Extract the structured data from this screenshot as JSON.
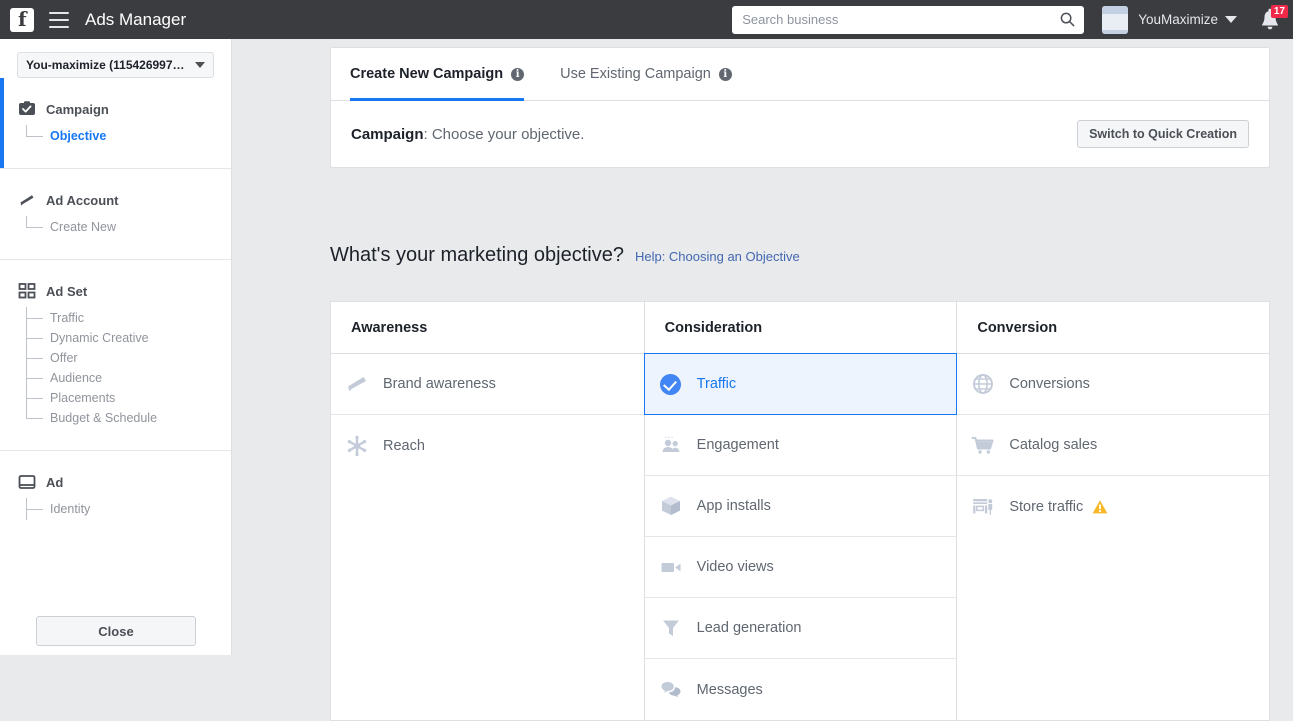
{
  "topbar": {
    "logo_icon": "facebook-logo-icon",
    "menu_icon": "hamburger-menu-icon",
    "app_title": "Ads Manager",
    "search": {
      "placeholder": "Search business",
      "value": "",
      "icon": "search-icon"
    },
    "business_icon": "business-portfolio-icon",
    "business_name": "YouMaximize",
    "business_caret_icon": "chevron-down-icon",
    "notifications": {
      "icon": "bell-icon",
      "count": "17"
    }
  },
  "sidebar": {
    "account_selector": {
      "label": "You-maximize (115426997…",
      "caret_icon": "chevron-down-icon"
    },
    "sections": [
      {
        "title": "Campaign",
        "icon": "campaign-check-icon",
        "active": true,
        "children": [
          {
            "label": "Objective",
            "selected": true
          }
        ]
      },
      {
        "title": "Ad Account",
        "icon": "megaphone-icon",
        "active": false,
        "children": [
          {
            "label": "Create New",
            "selected": false
          }
        ]
      },
      {
        "title": "Ad Set",
        "icon": "grid-squares-icon",
        "active": false,
        "children": [
          {
            "label": "Traffic",
            "selected": false
          },
          {
            "label": "Dynamic Creative",
            "selected": false
          },
          {
            "label": "Offer",
            "selected": false
          },
          {
            "label": "Audience",
            "selected": false
          },
          {
            "label": "Placements",
            "selected": false
          },
          {
            "label": "Budget & Schedule",
            "selected": false
          }
        ]
      },
      {
        "title": "Ad",
        "icon": "ad-window-icon",
        "active": false,
        "children": [
          {
            "label": "Identity",
            "selected": false
          }
        ]
      }
    ],
    "close_button": "Close"
  },
  "main": {
    "tabs": [
      {
        "label": "Create New Campaign",
        "active": true,
        "info_icon": "info-icon",
        "info_glyph": "i"
      },
      {
        "label": "Use Existing Campaign",
        "active": false,
        "info_icon": "info-icon",
        "info_glyph": "i"
      }
    ],
    "campaign_bar": {
      "bold_prefix": "Campaign",
      "rest_text": ": Choose your objective.",
      "quick_button": "Switch to Quick Creation"
    },
    "objective_heading": "What's your marketing objective?",
    "help_link": "Help: Choosing an Objective",
    "columns": [
      {
        "header": "Awareness",
        "items": [
          {
            "label": "Brand awareness",
            "icon": "megaphone-icon",
            "selected": false,
            "warning": false
          },
          {
            "label": "Reach",
            "icon": "reach-burst-icon",
            "selected": false,
            "warning": false
          }
        ]
      },
      {
        "header": "Consideration",
        "items": [
          {
            "label": "Traffic",
            "icon": "check-circle-icon",
            "selected": true,
            "warning": false
          },
          {
            "label": "Engagement",
            "icon": "people-icon",
            "selected": false,
            "warning": false
          },
          {
            "label": "App installs",
            "icon": "app-box-icon",
            "selected": false,
            "warning": false
          },
          {
            "label": "Video views",
            "icon": "video-camera-icon",
            "selected": false,
            "warning": false
          },
          {
            "label": "Lead generation",
            "icon": "funnel-icon",
            "selected": false,
            "warning": false
          },
          {
            "label": "Messages",
            "icon": "messages-bubble-icon",
            "selected": false,
            "warning": false
          }
        ]
      },
      {
        "header": "Conversion",
        "items": [
          {
            "label": "Conversions",
            "icon": "globe-icon",
            "selected": false,
            "warning": false
          },
          {
            "label": "Catalog sales",
            "icon": "shopping-cart-icon",
            "selected": false,
            "warning": false
          },
          {
            "label": "Store traffic",
            "icon": "storefront-icon",
            "selected": false,
            "warning": true,
            "warning_icon": "warning-triangle-icon"
          }
        ]
      }
    ]
  },
  "colors": {
    "brand_blue": "#1877f2",
    "topbar_bg": "#3b3c40",
    "page_bg": "#e9eaec",
    "selected_row_bg": "#edf4fe",
    "badge_red": "#f02849",
    "warning_amber": "#f7b928",
    "link_blue": "#4267b2",
    "muted_text": "#606770",
    "icon_gray": "#c3cbd9"
  }
}
